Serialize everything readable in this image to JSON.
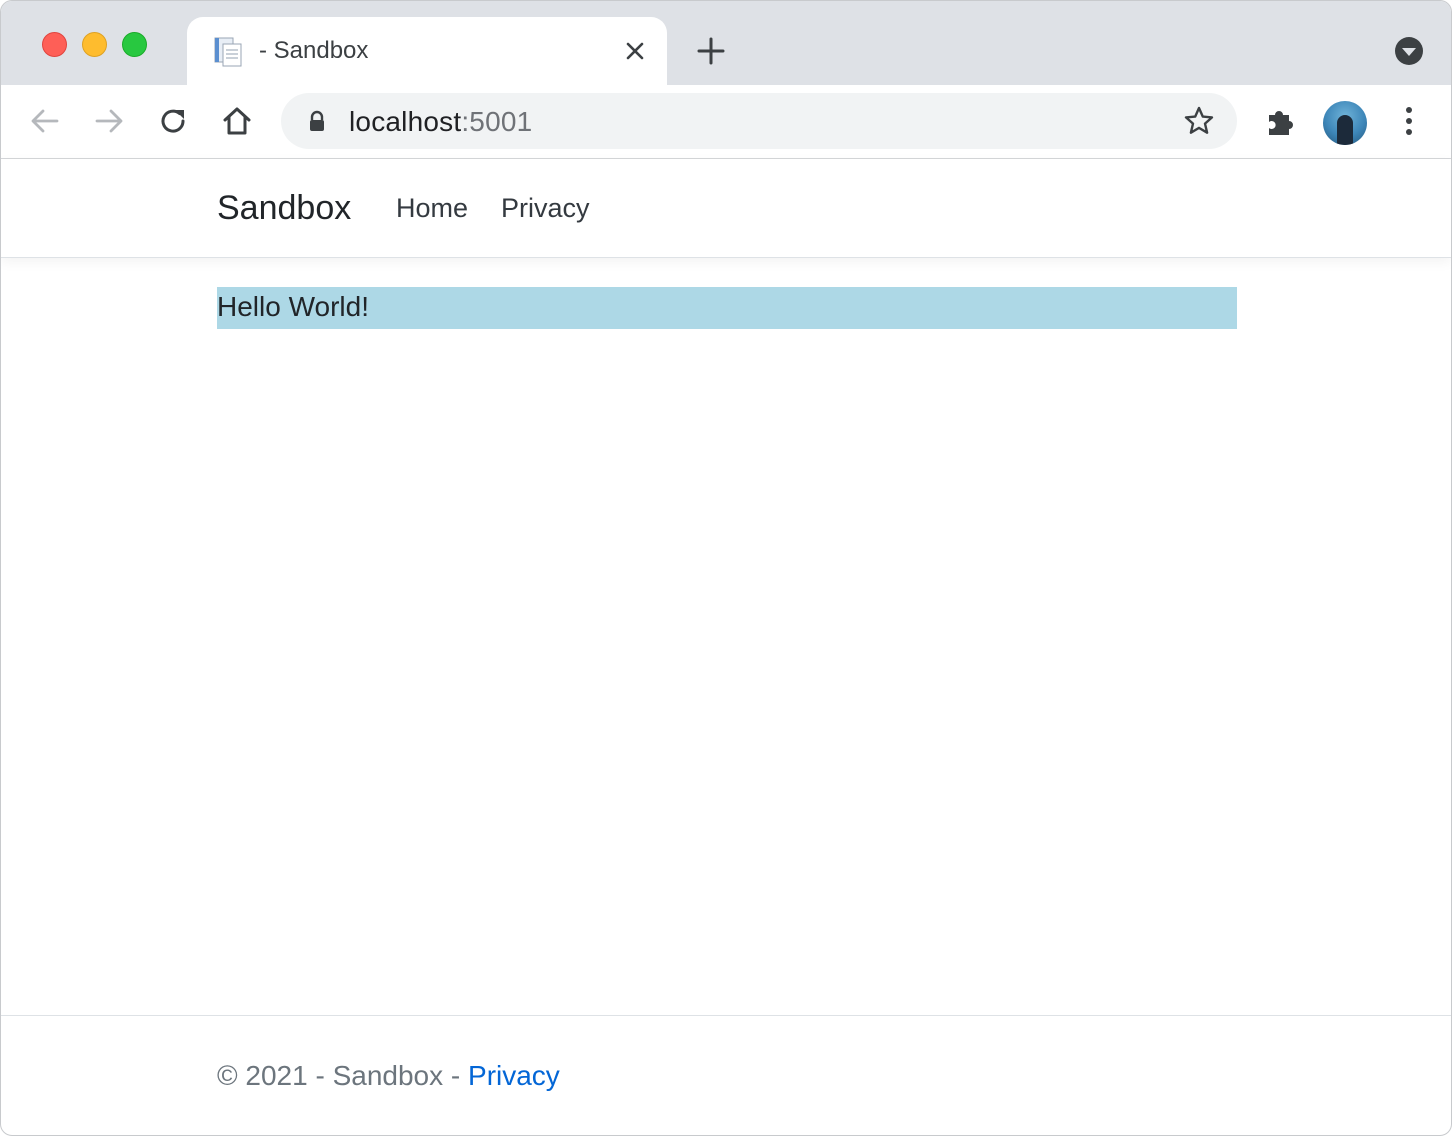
{
  "browser": {
    "tab": {
      "title": "- Sandbox",
      "favicon": "document-icon"
    },
    "address": {
      "host": "localhost",
      "port": ":5001"
    },
    "toolbar_icons": [
      "back-arrow-icon",
      "forward-arrow-icon",
      "reload-icon",
      "home-icon",
      "lock-icon",
      "star-icon",
      "puzzle-icon",
      "avatar",
      "kebab-menu-icon"
    ]
  },
  "page": {
    "navbar": {
      "brand": "Sandbox",
      "links": [
        {
          "label": "Home"
        },
        {
          "label": "Privacy"
        }
      ]
    },
    "main": {
      "message": "Hello World!",
      "message_bg": "#add8e6"
    },
    "footer": {
      "text": "© 2021 - Sandbox - ",
      "link": "Privacy",
      "link_color": "#0366d6"
    }
  }
}
